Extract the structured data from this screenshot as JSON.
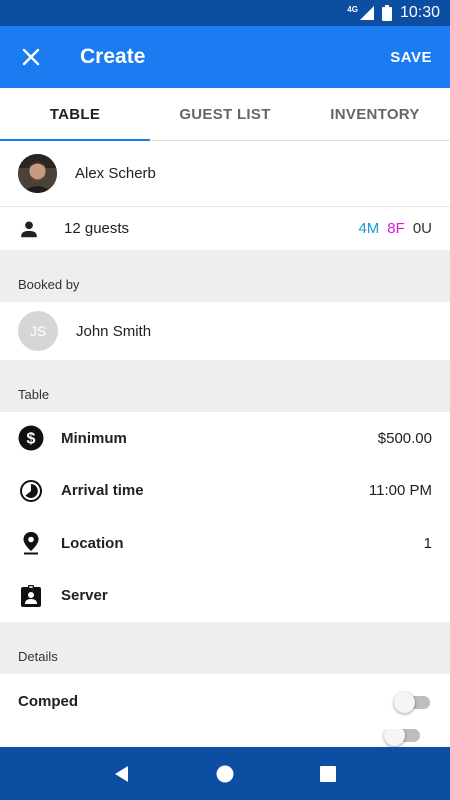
{
  "status_bar": {
    "network": "4G",
    "time": "10:30"
  },
  "app_bar": {
    "title": "Create",
    "save_label": "SAVE"
  },
  "tabs": [
    {
      "label": "TABLE",
      "active": true
    },
    {
      "label": "GUEST LIST",
      "active": false
    },
    {
      "label": "INVENTORY",
      "active": false
    }
  ],
  "guest": {
    "name": "Alex Scherb"
  },
  "guests": {
    "label": "12 guests",
    "male": "4M",
    "female": "8F",
    "unknown": "0U"
  },
  "booked_by": {
    "section_label": "Booked by",
    "initials": "JS",
    "name": "John Smith"
  },
  "table": {
    "section_label": "Table",
    "fields": [
      {
        "label": "Minimum",
        "value": "$500.00",
        "icon": "dollar-icon"
      },
      {
        "label": "Arrival time",
        "value": "11:00 PM",
        "icon": "clock-icon"
      },
      {
        "label": "Location",
        "value": "1",
        "icon": "location-pin-icon"
      },
      {
        "label": "Server",
        "value": "",
        "icon": "badge-icon"
      }
    ]
  },
  "details": {
    "section_label": "Details",
    "comped_label": "Comped",
    "comped": false
  },
  "colors": {
    "primary": "#1a7cf0",
    "primary_dark": "#0b4ea2",
    "male": "#1a9ad6",
    "female": "#d81bd6"
  }
}
